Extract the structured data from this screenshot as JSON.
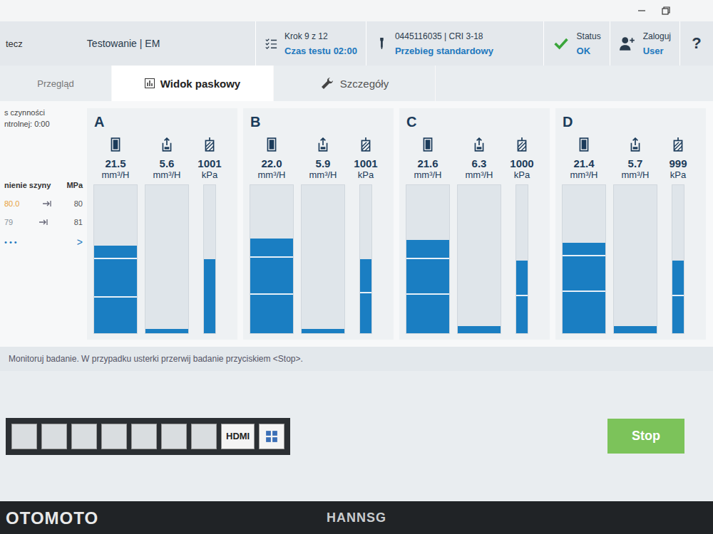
{
  "header": {
    "app_cut": "tecz",
    "title": "Testowanie | EM",
    "step": "Krok 9 z 12",
    "test_time": "Czas testu 02:00",
    "part": "0445116035 | CRI 3-18",
    "run": "Przebieg standardowy",
    "status_label": "Status",
    "status_value": "OK",
    "login": "Zaloguj",
    "user": "User",
    "help": "?"
  },
  "tabs": [
    {
      "label": "Przegląd",
      "selected": false
    },
    {
      "label": "Widok paskowy",
      "selected": true
    },
    {
      "label": "Szczegóły",
      "selected": false
    }
  ],
  "sidebar": {
    "lines": [
      "s czynności",
      "ntrolnej: 0:00"
    ],
    "section": "nienie szyny",
    "unit": "MPa",
    "rows": [
      {
        "value": "80.0",
        "target": "80",
        "color": "#e8a13a"
      },
      {
        "value": "79",
        "target": "81",
        "color": "#8a949c"
      }
    ],
    "more": "• • •",
    "next": ">"
  },
  "groups": [
    {
      "label": "A",
      "bars": [
        {
          "kind": "flow",
          "value": "21.5",
          "unit": "mm³/H",
          "level": 0.59,
          "marks": [
            0.5,
            0.24
          ]
        },
        {
          "kind": "return",
          "value": "5.6",
          "unit": "mm³/H",
          "level": 0.03,
          "marks": []
        },
        {
          "kind": "pressure",
          "value": "1001",
          "unit": "kPa",
          "level": 0.5,
          "marks": []
        }
      ]
    },
    {
      "label": "B",
      "bars": [
        {
          "kind": "flow",
          "value": "22.0",
          "unit": "mm³/H",
          "level": 0.64,
          "marks": [
            0.51,
            0.26
          ]
        },
        {
          "kind": "return",
          "value": "5.9",
          "unit": "mm³/H",
          "level": 0.03,
          "marks": []
        },
        {
          "kind": "pressure",
          "value": "1001",
          "unit": "kPa",
          "level": 0.5,
          "marks": [
            0.27
          ]
        }
      ]
    },
    {
      "label": "C",
      "bars": [
        {
          "kind": "flow",
          "value": "21.6",
          "unit": "mm³/H",
          "level": 0.63,
          "marks": [
            0.5,
            0.26
          ]
        },
        {
          "kind": "return",
          "value": "6.3",
          "unit": "mm³/H",
          "level": 0.05,
          "marks": []
        },
        {
          "kind": "pressure",
          "value": "1000",
          "unit": "kPa",
          "level": 0.49,
          "marks": [
            0.25
          ]
        }
      ]
    },
    {
      "label": "D",
      "bars": [
        {
          "kind": "flow",
          "value": "21.4",
          "unit": "mm³/H",
          "level": 0.61,
          "marks": [
            0.52,
            0.28
          ]
        },
        {
          "kind": "return",
          "value": "5.7",
          "unit": "mm³/H",
          "level": 0.05,
          "marks": []
        },
        {
          "kind": "pressure",
          "value": "999",
          "unit": "kPa",
          "level": 0.49,
          "marks": [
            0.25
          ]
        }
      ]
    }
  ],
  "message": "Monitoruj badanie. W przypadku usterki przerwij badanie przyciskiem <Stop>.",
  "stop_button": "Stop",
  "taskbar": {
    "label": "HDMI"
  },
  "bezel": "HANNSG",
  "watermark": "OTOMOTO"
}
